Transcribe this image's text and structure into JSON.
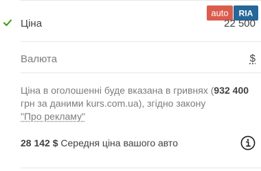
{
  "logo": {
    "word_auto": "auto",
    "word_ria": "RIA"
  },
  "price": {
    "label": "Ціна",
    "value": "22 500",
    "status_icon": "check-icon",
    "status_color": "#3c9806"
  },
  "currency": {
    "label": "Валюта",
    "selected": "$"
  },
  "note": {
    "text_before": "Ціна в оголошенні буде вказана в гривнях (",
    "uah_amount": "932 400",
    "text_middle": " грн за даними kurs.com.ua), згідно закону ",
    "law_link": "\"Про рекламу\""
  },
  "average": {
    "amount": "28 142 $",
    "label": " Середня ціна вашого авто",
    "info_icon": "info-icon"
  },
  "colors": {
    "brand_red": "#db5c4c",
    "brand_blue": "#256799",
    "text_dark": "#414042",
    "text_muted": "#7c7c7c",
    "divider": "#e6e6e6"
  }
}
